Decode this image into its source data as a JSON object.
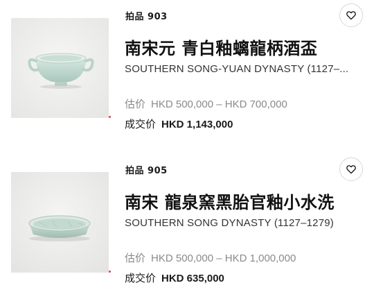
{
  "lots": [
    {
      "lot_number": "拍品 903",
      "title": "南宋元 青白釉螭龍柄酒盃",
      "subtitle": "SOUTHERN SONG-YUAN DYNASTY (1127–...",
      "estimate_label": "估价",
      "estimate_value": "HKD 500,000 – HKD 700,000",
      "sold_label": "成交价",
      "sold_value": "HKD 1,143,000",
      "image": "celadon-wine-cup-with-handles"
    },
    {
      "lot_number": "拍品 905",
      "title": "南宋 龍泉窯黑胎官釉小水洗",
      "subtitle": "SOUTHERN SONG DYNASTY (1127–1279)",
      "estimate_label": "估价",
      "estimate_value": "HKD 500,000 – HKD 1,000,000",
      "sold_label": "成交价",
      "sold_value": "HKD 635,000",
      "image": "celadon-brush-washer"
    }
  ],
  "icons": {
    "favorite": "heart-outline-icon"
  },
  "colors": {
    "accent_dot": "#e23a3a",
    "muted_text": "#8a8a8a",
    "thumb_bg": "#ededed"
  }
}
